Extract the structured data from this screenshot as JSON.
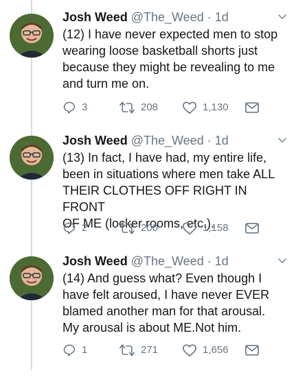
{
  "tweets": [
    {
      "author": "Josh Weed",
      "handle": "@The_Weed",
      "dot": "·",
      "time": "1d",
      "lines": [
        "(12) I have never expected men to stop",
        "wearing loose basketball shorts just",
        "because they might be revealing to me",
        "and turn me on."
      ],
      "replies": "3",
      "retweets": "208",
      "likes": "1,130"
    },
    {
      "author": "Josh Weed",
      "handle": "@The_Weed",
      "dot": "·",
      "time": "1d",
      "lines": [
        "(13) In fact, I have had, my entire life,",
        "been in situations where men take ALL",
        "THEIR CLOTHES OFF RIGHT IN FRONT",
        "OF ME (locker rooms, etc.)."
      ],
      "replies": "2",
      "retweets": "200",
      "likes": "1,158"
    },
    {
      "author": "Josh Weed",
      "handle": "@The_Weed",
      "dot": "·",
      "time": "1d",
      "lines": [
        "(14) And guess what? Even though I",
        "have felt aroused, I have never EVER",
        "blamed another man for that arousal.",
        "My arousal is about ME.Not him."
      ],
      "replies": "1",
      "retweets": "271",
      "likes": "1,656"
    }
  ],
  "colors": {
    "text": "#14171a",
    "secondary": "#657786",
    "thread_line": "#d5dde3",
    "avatar_bg": "#3f5f2c"
  },
  "icons": [
    "reply-icon",
    "retweet-icon",
    "like-icon",
    "direct-message-icon",
    "chevron-down-icon"
  ]
}
